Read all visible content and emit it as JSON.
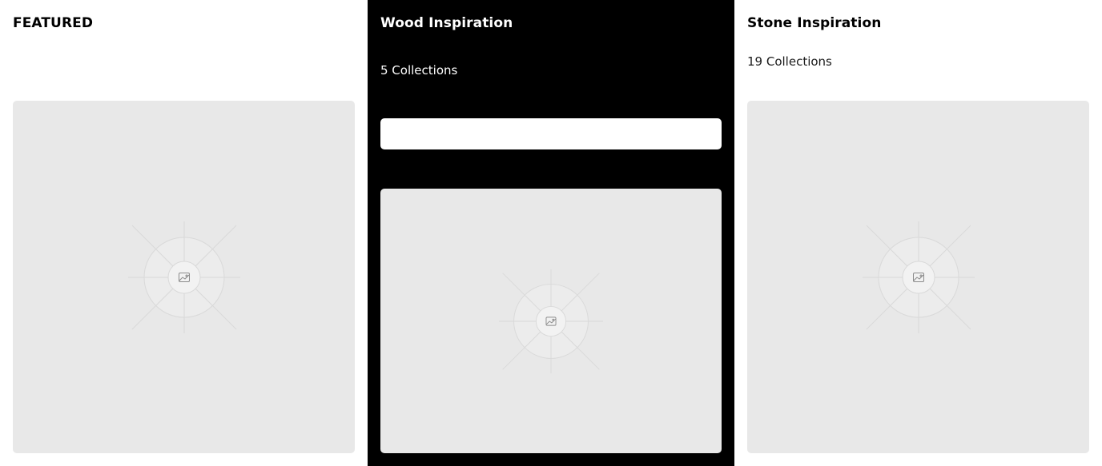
{
  "featured": {
    "title": "FEATURED",
    "image_icon": "image-placeholder-icon"
  },
  "wood": {
    "title": "Wood Inspiration",
    "count": "5 Collections",
    "image_icon": "image-placeholder-icon"
  },
  "stone": {
    "title": "Stone Inspiration",
    "count": "19 Collections",
    "image_icon": "image-placeholder-icon"
  },
  "colors": {
    "placeholder_bg": "#e8e8e8",
    "dark_panel": "#000000",
    "light_panel": "#ffffff"
  }
}
